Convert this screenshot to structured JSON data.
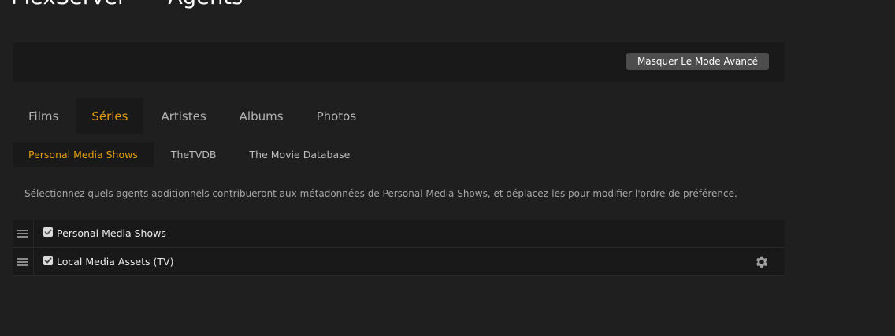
{
  "header": {
    "server_name": "PlexServer",
    "separator": "·",
    "section": "Agents"
  },
  "toolbar": {
    "mode_button_label": "Masquer Le Mode Avancé"
  },
  "tabs": [
    {
      "label": "Films",
      "active": false
    },
    {
      "label": "Séries",
      "active": true
    },
    {
      "label": "Artistes",
      "active": false
    },
    {
      "label": "Albums",
      "active": false
    },
    {
      "label": "Photos",
      "active": false
    }
  ],
  "subtabs": [
    {
      "label": "Personal Media Shows",
      "active": true
    },
    {
      "label": "TheTVDB",
      "active": false
    },
    {
      "label": "The Movie Database",
      "active": false
    }
  ],
  "description": "Sélectionnez quels agents additionnels contribueront aux métadonnées de Personal Media Shows, et déplacez-les pour modifier l'ordre de préférence.",
  "agents": [
    {
      "label": "Personal Media Shows",
      "checked": true,
      "disabled": true,
      "has_settings": false
    },
    {
      "label": "Local Media Assets (TV)",
      "checked": true,
      "disabled": false,
      "has_settings": true
    }
  ],
  "colors": {
    "accent": "#e5a00d",
    "background": "#1f1f1f",
    "panel": "#191919",
    "button": "#4d4d4d"
  },
  "icons": {
    "drag": "drag-handle-icon",
    "checkbox": "checkmark-icon",
    "settings": "gear-icon"
  }
}
